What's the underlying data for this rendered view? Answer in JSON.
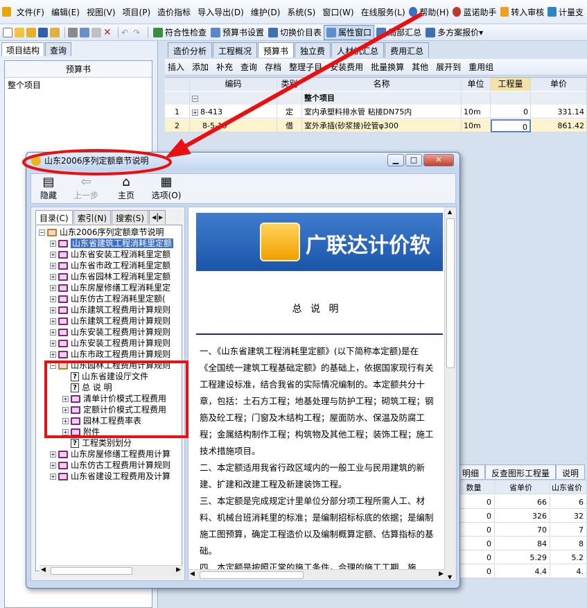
{
  "menu": [
    "文件(F)",
    "编辑(E)",
    "视图(V)",
    "项目(P)",
    "造价指标",
    "导入导出(D)",
    "维护(D)",
    "系统(S)",
    "窗口(W)",
    "在线服务(L)",
    "帮助(H)",
    "蓝诺助手",
    "转入审核",
    "计量支"
  ],
  "toolbar": {
    "check": "符合性检查",
    "budget_settings": "预算书设置",
    "switch_budget": "切换价目表",
    "property_window": "属性窗口",
    "local_summary": "局部汇总",
    "multi_plan": "多方案报价"
  },
  "left": {
    "tabs": [
      "项目结构",
      "查询"
    ],
    "header": "预算书",
    "root": "整个项目"
  },
  "right": {
    "tabs": [
      "造价分析",
      "工程概况",
      "预算书",
      "独立费",
      "人材机汇总",
      "费用汇总"
    ],
    "tools": [
      "插入",
      "添加",
      "补充",
      "查询",
      "存档",
      "整理子目",
      "安装费用",
      "批量换算",
      "其他",
      "展开到",
      "重用组"
    ],
    "headers": [
      "编码",
      "类别",
      "名称",
      "单位",
      "工程量",
      "单价"
    ],
    "rows": [
      {
        "no": "",
        "code": "",
        "type": "",
        "name": "整个项目",
        "unit": "",
        "qty": "",
        "price": ""
      },
      {
        "no": "1",
        "code": "8-413",
        "type": "定",
        "name": "室内承塑料排水管 粘接DN75内",
        "unit": "10m",
        "qty": "0",
        "price": "331.14"
      },
      {
        "no": "2",
        "code": "8-5-19",
        "type": "借",
        "name": "室外承插(砂浆接)砼管φ300",
        "unit": "10m",
        "qty": "0",
        "price": "861.42"
      }
    ]
  },
  "bottom": {
    "tabs": [
      "明细",
      "反查图形工程量",
      "说明"
    ],
    "headers": [
      "数量",
      "省单价",
      "山东省价"
    ],
    "rows": [
      [
        "0",
        "66",
        "6"
      ],
      [
        "0",
        "326",
        "32"
      ],
      [
        "0",
        "70",
        "7"
      ],
      [
        "0",
        "84",
        "8"
      ],
      [
        "0",
        "5.29",
        "5.2"
      ],
      [
        "0",
        "4.4",
        "4."
      ]
    ]
  },
  "help": {
    "title": "山东2006序列定额章节说明",
    "toolbar": [
      "隐藏",
      "上一步",
      "主页",
      "选项(O)"
    ],
    "nav_tabs": [
      "目录(C)",
      "索引(N)",
      "搜索(S)"
    ],
    "tree": [
      {
        "label": "山东2006序列定额章节说明",
        "level": 0,
        "kind": "book-open",
        "pm": "−"
      },
      {
        "label": "山东省建筑工程消耗里定额",
        "level": 1,
        "kind": "book",
        "pm": "+",
        "selected": true
      },
      {
        "label": "山东省安装工程消耗里定额",
        "level": 1,
        "kind": "book",
        "pm": "+"
      },
      {
        "label": "山东省市政工程消耗里定额",
        "level": 1,
        "kind": "book",
        "pm": "+"
      },
      {
        "label": "山东省园林工程消耗里定额",
        "level": 1,
        "kind": "book",
        "pm": "+"
      },
      {
        "label": "山东房屋修缮工程消耗里定",
        "level": 1,
        "kind": "book",
        "pm": "+"
      },
      {
        "label": "山东仿古工程消耗里定额(",
        "level": 1,
        "kind": "book",
        "pm": "+"
      },
      {
        "label": "山东建筑工程费用计算规则",
        "level": 1,
        "kind": "book",
        "pm": "+"
      },
      {
        "label": "山东建筑工程费用计算规则",
        "level": 1,
        "kind": "book",
        "pm": "+"
      },
      {
        "label": "山东安装工程费用计算规则",
        "level": 1,
        "kind": "book",
        "pm": "+"
      },
      {
        "label": "山东安装工程费用计算规则",
        "level": 1,
        "kind": "book",
        "pm": "+"
      },
      {
        "label": "山东市政工程费用计算规则",
        "level": 1,
        "kind": "book",
        "pm": "+"
      },
      {
        "label": "山东园林工程费用计算规则",
        "level": 1,
        "kind": "book-open",
        "pm": "−"
      },
      {
        "label": "山东省建设厅文件",
        "level": 2,
        "kind": "page",
        "pm": ""
      },
      {
        "label": "总 说 明",
        "level": 2,
        "kind": "page",
        "pm": ""
      },
      {
        "label": "清单计价模式工程费用",
        "level": 2,
        "kind": "book",
        "pm": "+"
      },
      {
        "label": "定额计价模式工程费用",
        "level": 2,
        "kind": "book",
        "pm": "+"
      },
      {
        "label": "园林工程费率表",
        "level": 2,
        "kind": "book",
        "pm": "+"
      },
      {
        "label": "附件",
        "level": 2,
        "kind": "book",
        "pm": "+"
      },
      {
        "label": "工程类别划分",
        "level": 2,
        "kind": "page",
        "pm": ""
      },
      {
        "label": "山东房屋修缮工程费用计算",
        "level": 1,
        "kind": "book",
        "pm": "+"
      },
      {
        "label": "山东仿古工程费用计算规则",
        "level": 1,
        "kind": "book",
        "pm": "+"
      },
      {
        "label": "山东省建设工程费用及计算",
        "level": 1,
        "kind": "book",
        "pm": "+"
      }
    ],
    "banner": "广联达计价软",
    "content_title": "总 说 明",
    "paragraphs": [
      "一、《山东省建筑工程消耗里定额》(以下简称本定额)是在《全国统一建筑工程基础定额》的基础上，依据国家现行有关工程建设标准，结合我省的实际情况编制的。本定额共分十章，包括：土石方工程；地基处理与防护工程；砌筑工程；钢筋及砼工程；门窗及木结构工程；屋面防水、保温及防腐工程；金属结构制作工程；构筑物及其他工程；装饰工程；施工技术措施项目。",
      "二、本定额适用我省行政区域内的一般工业与民用建筑的新建、扩建和改建工程及新建装饰工程。",
      "三、本定额是完成规定计里单位分部分项工程所需人工、材料、机械台班消耗里的标准；是编制招标标底的依据；是编制施工图预算，确定工程造价以及编制概算定额、估算指标的基础。",
      "四、本定额是按照正常的施工条件，合理的施工工期、施"
    ]
  }
}
